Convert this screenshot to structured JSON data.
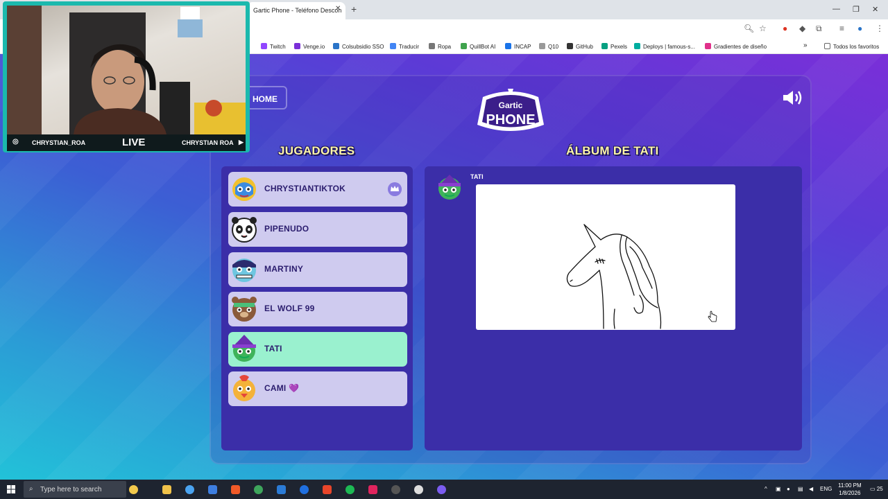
{
  "browser": {
    "tab_title": "Gartic Phone - Teléfono Descon",
    "tab_close": "✕",
    "new_tab": "+",
    "bookmarks": [
      {
        "label": "Twitch",
        "color": "#9146ff"
      },
      {
        "label": "Venge.io",
        "color": "#7b2fd8"
      },
      {
        "label": "Colsubsidio SSO",
        "color": "#2a74c8"
      },
      {
        "label": "Traducir",
        "color": "#4285f4"
      },
      {
        "label": "Ropa",
        "color": "#777777"
      },
      {
        "label": "QuillBot AI",
        "color": "#3fa34d"
      },
      {
        "label": "INCAP",
        "color": "#1a73e8"
      },
      {
        "label": "Q10",
        "color": "#999999"
      },
      {
        "label": "GitHub",
        "color": "#333333"
      },
      {
        "label": "Pexels",
        "color": "#05a081"
      },
      {
        "label": "Deploys | famous-s...",
        "color": "#00ad9f"
      },
      {
        "label": "Gradientes de diseño",
        "color": "#e0308a"
      }
    ],
    "all_favorites": "Todos los favoritos"
  },
  "stream": {
    "handle_left": "CHRYSTIAN_ROA",
    "live": "LIVE",
    "handle_right": "CHRYSTIAN ROA"
  },
  "game": {
    "home_label": "HOME",
    "logo_top": "Gartic",
    "logo_bottom": "PHONE",
    "players_heading": "JUGADORES",
    "album_heading": "ÁLBUM DE TATI",
    "players": [
      {
        "name": "CHRYSTIANTIKTOK",
        "avatar": "luchador",
        "host": true,
        "active": false
      },
      {
        "name": "PIPENUDO",
        "avatar": "panda",
        "host": false,
        "active": false
      },
      {
        "name": "MARTINY",
        "avatar": "monster",
        "host": false,
        "active": false
      },
      {
        "name": "EL WOLF 99",
        "avatar": "bear",
        "host": false,
        "active": false
      },
      {
        "name": "TATI",
        "avatar": "witch",
        "host": false,
        "active": true
      },
      {
        "name": "CAMI 💜",
        "avatar": "bird",
        "host": false,
        "active": false
      }
    ],
    "album_author": "TATI",
    "drawing_subject": "unicorn"
  },
  "taskbar": {
    "search_placeholder": "Type here to search",
    "lang": "ENG",
    "time": "11:00 PM",
    "date": "1/8/2026",
    "notifications": "25"
  }
}
